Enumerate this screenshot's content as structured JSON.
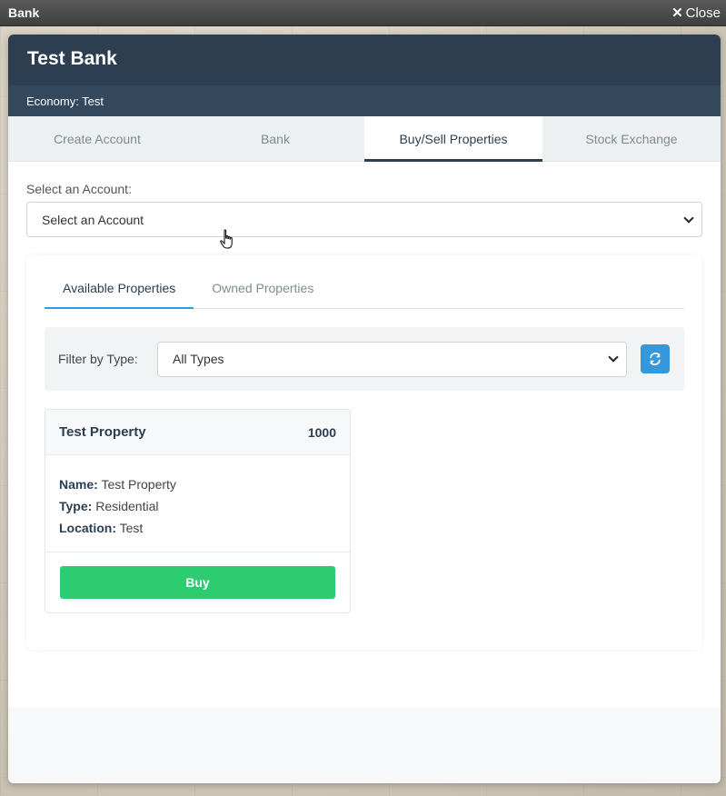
{
  "window": {
    "title": "Bank",
    "close_label": "Close"
  },
  "header": {
    "title": "Test Bank",
    "economy": "Economy: Test"
  },
  "tabs": [
    {
      "label": "Create Account"
    },
    {
      "label": "Bank"
    },
    {
      "label": "Buy/Sell Properties"
    },
    {
      "label": "Stock Exchange"
    }
  ],
  "account": {
    "label": "Select an Account:",
    "selected": "Select an Account"
  },
  "subtabs": [
    {
      "label": "Available Properties"
    },
    {
      "label": "Owned Properties"
    }
  ],
  "filter": {
    "label": "Filter by Type:",
    "selected": "All Types"
  },
  "property": {
    "title": "Test Property",
    "price": "1000",
    "name_label": "Name:",
    "name": "Test Property",
    "type_label": "Type:",
    "type": "Residential",
    "location_label": "Location:",
    "location": "Test",
    "buy_label": "Buy"
  },
  "colors": {
    "header": "#2c3e50",
    "economy_bar": "#34495e",
    "accent": "#3498db",
    "buy": "#2ecc71"
  }
}
